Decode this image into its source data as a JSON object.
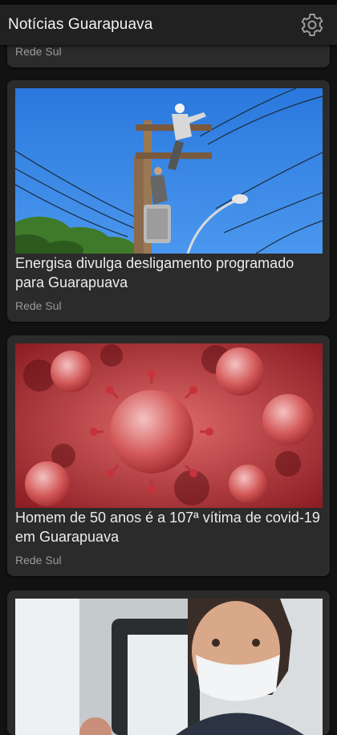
{
  "app": {
    "title": "Notícias Guarapuava",
    "settings_icon": "gear-icon"
  },
  "articles": [
    {
      "title": "",
      "source": "Rede Sul"
    },
    {
      "title": "Energisa divulga desligamento programado para Guarapuava",
      "source": "Rede Sul",
      "image": "power-pole-repair-photo"
    },
    {
      "title": "Homem de 50 anos é a 107ª vítima de covid-19 em Guarapuava",
      "source": "Rede Sul",
      "image": "coronavirus-illustration"
    },
    {
      "title": "",
      "source": "",
      "image": "masked-woman-photo"
    }
  ],
  "colors": {
    "background": "#121212",
    "card": "#2b2b2b",
    "appbar": "#212121",
    "sky": "#2f7fe0",
    "virus_red": "#c8323a"
  }
}
